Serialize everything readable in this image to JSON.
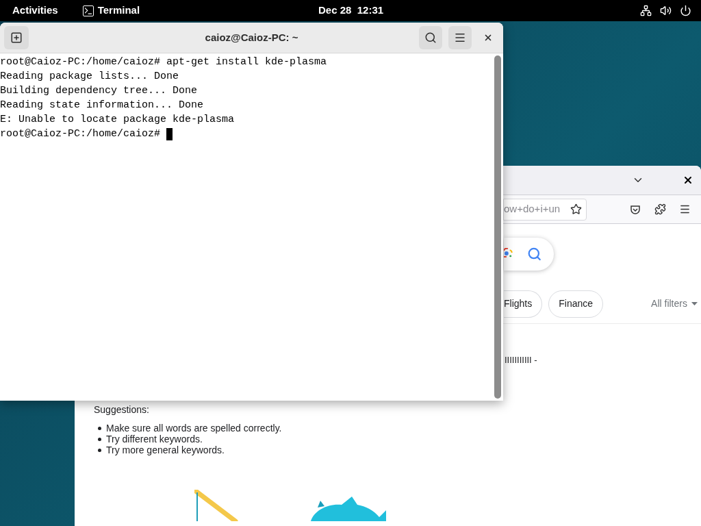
{
  "top_bar": {
    "activities": "Activities",
    "app": "Terminal",
    "clock": "Dec 28  12:31"
  },
  "terminal": {
    "title": "caioz@Caioz-PC: ~",
    "lines": [
      "root@Caioz-PC:/home/caioz# apt-get install kde-plasma",
      "Reading package lists... Done",
      "Building dependency tree... Done",
      "Reading state information... Done",
      "E: Unable to locate package kde-plasma",
      "root@Caioz-PC:/home/caioz# "
    ]
  },
  "browser": {
    "url_fragment": "ow+do+i+un",
    "chips": [
      {
        "label": "Flights"
      },
      {
        "label": "Finance"
      }
    ],
    "filters": "All filters",
    "result_fragment": "IIIIIIIIIII -",
    "suggestions_heading": "Suggestions:",
    "suggestions": [
      "Make sure all words are spelled correctly.",
      "Try different keywords.",
      "Try more general keywords."
    ]
  }
}
